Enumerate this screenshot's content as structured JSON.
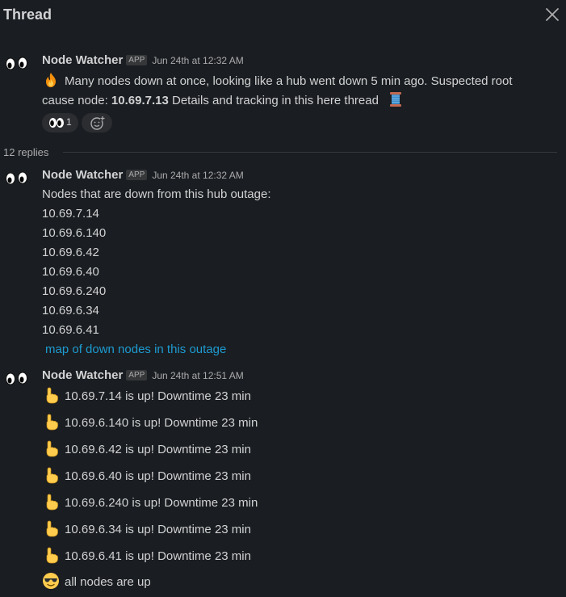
{
  "header": {
    "title": "Thread",
    "close_icon": "close-icon"
  },
  "parent_message": {
    "sender": "Node Watcher",
    "badge": "APP",
    "time": "Jun 24th at 12:32 AM",
    "line1": "Many nodes down at once, looking like a hub went down 5 min ago. Suspected root",
    "line2_prefix": "cause node: ",
    "line2_bold": "10.69.7.13",
    "line2_suffix": " Details and tracking in this here thread",
    "icons": [
      "fire-emoji",
      "thread-spool-emoji"
    ],
    "reactions": [
      {
        "icon": "eyes-emoji",
        "count": "1"
      },
      {
        "icon": "add-reaction-icon"
      }
    ]
  },
  "thread": {
    "replies_label": "12 replies"
  },
  "reply1": {
    "sender": "Node Watcher",
    "badge": "APP",
    "time": "Jun 24th at 12:32 AM",
    "intro": "Nodes that are down from this hub outage:",
    "nodes": [
      "10.69.7.14",
      "10.69.6.140",
      "10.69.6.42",
      "10.69.6.40",
      "10.69.6.240",
      "10.69.6.34",
      "10.69.6.41"
    ],
    "link": "map of down nodes in this outage"
  },
  "reply2": {
    "sender": "Node Watcher",
    "badge": "APP",
    "time": "Jun 24th at 12:51 AM",
    "lines": [
      "10.69.7.14 is up! Downtime 23 min",
      "10.69.6.140 is up! Downtime 23 min",
      "10.69.6.42 is up! Downtime 23 min",
      "10.69.6.40 is up! Downtime 23 min",
      "10.69.6.240 is up! Downtime 23 min",
      "10.69.6.34 is up! Downtime 23 min",
      "10.69.6.41 is up! Downtime 23 min"
    ],
    "line_icon": "pointing-up-emoji",
    "final_line": "all nodes are up",
    "final_icon": "sunglasses-emoji"
  }
}
